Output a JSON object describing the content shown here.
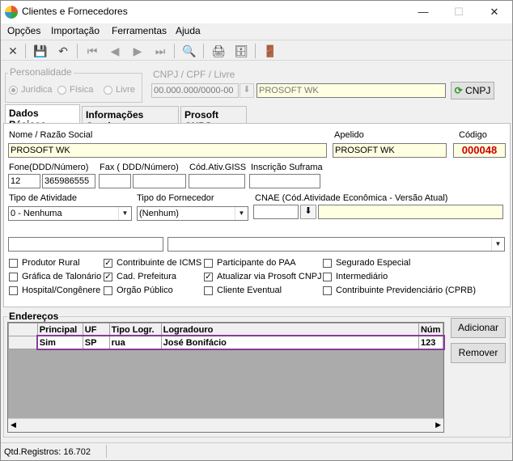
{
  "window": {
    "title": "Clientes e Fornecedores"
  },
  "menu": [
    "Opções",
    "Importação",
    "Ferramentas",
    "Ajuda"
  ],
  "personalidade": {
    "label": "Personalidade",
    "options": [
      "Jurídica",
      "Física",
      "Livre"
    ],
    "selected": "Jurídica"
  },
  "cnpj": {
    "label": "CNPJ / CPF / Livre",
    "value": "00.000.000/0000-00",
    "name": "PROSOFT WK",
    "button": "CNPJ"
  },
  "tabs": [
    "Dados Básicos",
    "Informações Gerais",
    "Prosoft CNPJ"
  ],
  "form": {
    "nome_label": "Nome / Razão Social",
    "nome": "PROSOFT WK",
    "apelido_label": "Apelido",
    "apelido": "PROSOFT WK",
    "codigo_label": "Código",
    "codigo": "000048",
    "fone_label": "Fone(DDD/Número)",
    "fone_ddd": "12",
    "fone_num": "365986555",
    "fax_label": "Fax ( DDD/Número)",
    "cod_giss_label": "Cód.Ativ.GISS",
    "suframa_label": "Inscrição Suframa",
    "tipo_atividade_label": "Tipo de Atividade",
    "tipo_atividade": "0 - Nenhuma",
    "tipo_fornecedor_label": "Tipo do Fornecedor",
    "tipo_fornecedor": "(Nenhum)",
    "cnae_label": "CNAE (Cód.Atividade Econômica - Versão Atual)"
  },
  "checkboxes": [
    {
      "label": "Produtor Rural",
      "checked": false
    },
    {
      "label": "Gráfica de Talonário",
      "checked": false
    },
    {
      "label": "Hospital/Congênere",
      "checked": false
    },
    {
      "label": "Contribuinte de ICMS",
      "checked": true
    },
    {
      "label": "Cad. Prefeitura",
      "checked": true
    },
    {
      "label": "Orgão Público",
      "checked": false
    },
    {
      "label": "Participante do PAA",
      "checked": false
    },
    {
      "label": "Atualizar via Prosoft CNPJ",
      "checked": true
    },
    {
      "label": "Cliente Eventual",
      "checked": false
    },
    {
      "label": "Segurado Especial",
      "checked": false
    },
    {
      "label": "Intermediário",
      "checked": false
    },
    {
      "label": "Contribuinte Previdenciário (CPRB)",
      "checked": false
    }
  ],
  "enderecos": {
    "label": "Endereços",
    "columns": [
      "Principal",
      "UF",
      "Tipo Logr.",
      "Logradouro",
      "Núm"
    ],
    "rows": [
      [
        "Sim",
        "SP",
        "rua",
        "José Bonifácio",
        "123"
      ]
    ],
    "add_button": "Adicionar",
    "remove_button": "Remover"
  },
  "status": {
    "text": "Qtd.Registros: 16.702"
  },
  "colors": {
    "codigo": "#cc0000",
    "highlight": "#8a3a9a"
  }
}
